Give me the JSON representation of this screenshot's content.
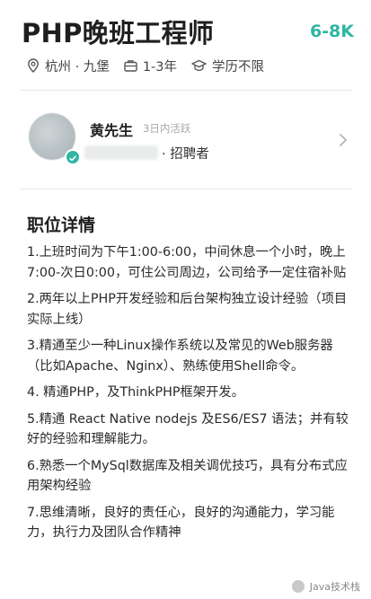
{
  "job": {
    "title": "PHP晚班工程师",
    "salary": "6-8K",
    "location": "杭州 · 九堡",
    "experience": "1-3年",
    "education": "学历不限"
  },
  "recruiter": {
    "name": "黄先生",
    "active": "3日内活跃",
    "role": "· 招聘者"
  },
  "section_title": "职位详情",
  "description": [
    "1.上班时间为下午1:00-6:00，中间休息一个小时，晚上7:00-次日0:00，可住公司周边，公司给予一定住宿补贴",
    "2.两年以上PHP开发经验和后台架构独立设计经验（项目实际上线）",
    "3.精通至少一种Linux操作系统以及常见的Web服务器（比如Apache、Nginx）、熟练使用Shell命令。",
    "4. 精通PHP，及ThinkPHP框架开发。",
    "5.精通 React Native nodejs 及ES6/ES7 语法；并有较好的经验和理解能力。",
    "6.熟悉一个MySql数据库及相关调优技巧，具有分布式应用架构经验",
    "7.思维清晰，良好的责任心，良好的沟通能力，学习能力，执行力及团队合作精神"
  ],
  "watermark": "Java技术栈",
  "colors": {
    "accent": "#2fb5a4"
  },
  "icons": [
    "location-icon",
    "briefcase-icon",
    "graduation-cap-icon",
    "chevron-right-icon",
    "verified-icon"
  ]
}
